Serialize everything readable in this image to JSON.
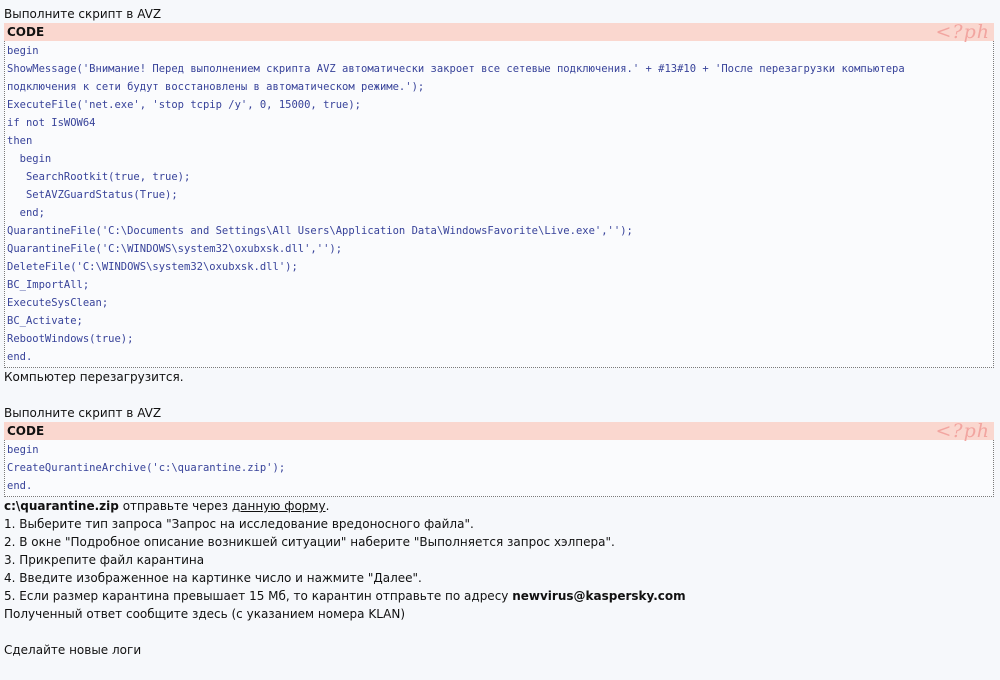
{
  "block1": {
    "intro": "Выполните скрипт в AVZ",
    "code_label": "CODE",
    "php_tag": "<?ph",
    "lines": [
      "begin",
      "ShowMessage('Внимание! Перед выполнением скрипта AVZ автоматически закроет все сетевые подключения.' + #13#10 + 'После перезагрузки компьютера",
      "подключения к сети будут восстановлены в автоматическом режиме.');",
      "ExecuteFile('net.exe', 'stop tcpip /y', 0, 15000, true);",
      "if not IsWOW64",
      "then",
      "  begin",
      "   SearchRootkit(true, true);",
      "   SetAVZGuardStatus(True);",
      "  end;",
      "QuarantineFile('C:\\Documents and Settings\\All Users\\Application Data\\WindowsFavorite\\Live.exe','');",
      "QuarantineFile('C:\\WINDOWS\\system32\\oxubxsk.dll','');",
      "DeleteFile('C:\\WINDOWS\\system32\\oxubxsk.dll');",
      "BC_ImportAll;",
      "ExecuteSysClean;",
      "BC_Activate;",
      "RebootWindows(true);",
      "end."
    ],
    "after": "Компьютер перезагрузится."
  },
  "block2": {
    "intro": "Выполните скрипт в AVZ",
    "code_label": "CODE",
    "php_tag": "<?ph",
    "lines": [
      "begin",
      "CreateQurantineArchive('c:\\quarantine.zip');",
      "end."
    ]
  },
  "send": {
    "file": "c:\\quarantine.zip",
    "text": " отправьте через ",
    "link": "данную форму",
    "end": "."
  },
  "steps": [
    "1. Выберите тип запроса \"Запрос на исследование вредоносного файла\".",
    "2. В окне \"Подробное описание возникшей ситуации\" наберите \"Выполняется запрос хэлпера\".",
    "3. Прикрепите файл карантина",
    "4. Введите изображенное на картинке число и нажмите \"Далее\"."
  ],
  "step5": {
    "text": "5. Если размер карантина превышает 15 Мб, то карантин отправьте по адресу ",
    "email": "newvirus@kaspersky.com"
  },
  "reply": "Полученный ответ сообщите здесь (с указанием номера KLAN)",
  "final": "Сделайте новые логи"
}
